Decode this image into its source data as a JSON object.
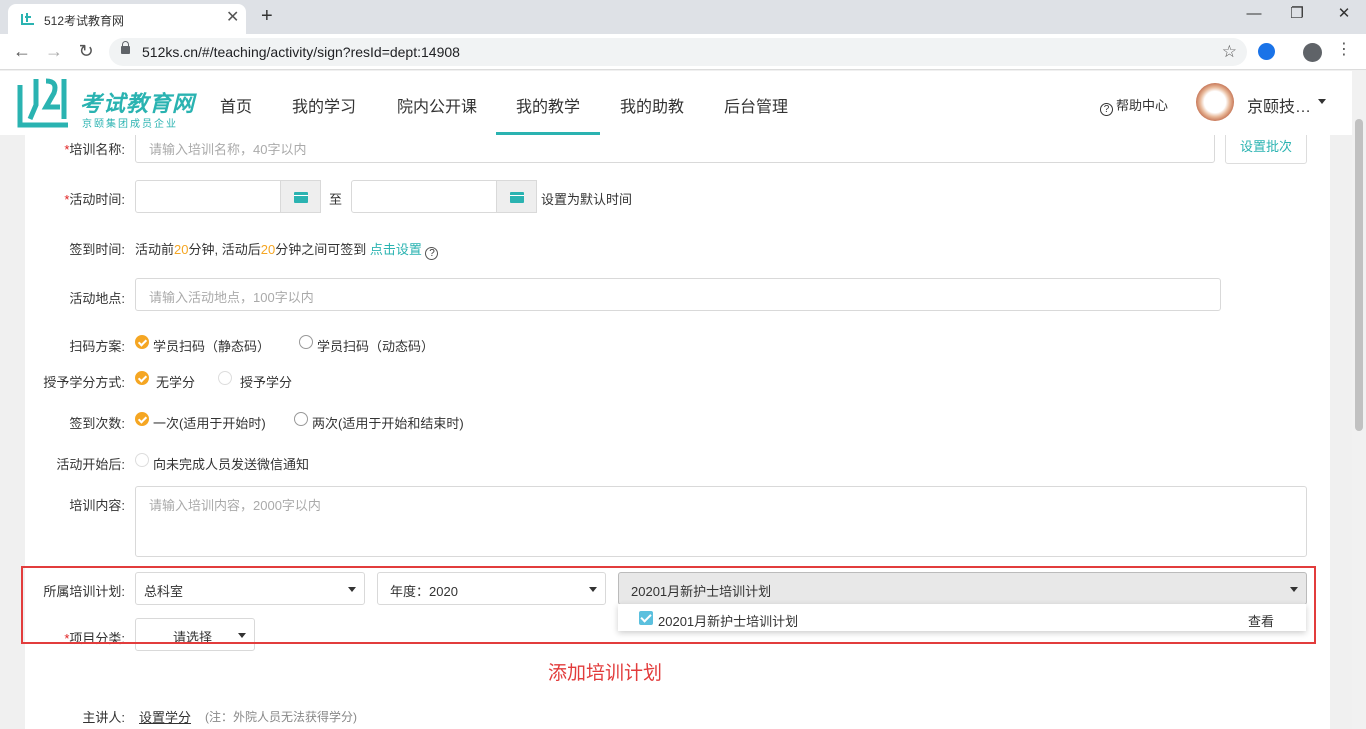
{
  "browser": {
    "tab_title": "512考试教育网",
    "close_glyph": "✕",
    "new_tab_glyph": "+",
    "win_min": "—",
    "win_max": "❐",
    "win_close": "✕",
    "back": "←",
    "forward": "→",
    "reload": "↻",
    "url": "512ks.cn/#/teaching/activity/sign?resId=dept:14908",
    "star": "☆",
    "kebab": "⋮"
  },
  "header": {
    "logo_text": "考试教育网",
    "logo_sub": "京颐集团成员企业",
    "menu": [
      "首页",
      "我的学习",
      "院内公开课",
      "我的教学",
      "我的助教",
      "后台管理"
    ],
    "active_menu": "我的教学",
    "help_icon": "?",
    "help_label": "帮助中心",
    "user_name": "京颐技…"
  },
  "form": {
    "training_name": {
      "req": "*",
      "label": "培训名称:",
      "placeholder": "请输入培训名称，40字以内",
      "batch_btn": "设置批次"
    },
    "activity_time": {
      "req": "*",
      "label": "活动时间:",
      "to": "至",
      "default_link": "设置为默认时间"
    },
    "sign_time": {
      "label": "签到时间:",
      "t1": "活动前",
      "n1": "20",
      "t2": "分钟, 活动后",
      "n2": "20",
      "t3": "分钟之间可签到",
      "link": "点击设置",
      "q": "?"
    },
    "location": {
      "label": "活动地点:",
      "placeholder": "请输入活动地点，100字以内"
    },
    "scan": {
      "label": "扫码方案:",
      "opt1": "学员扫码（静态码）",
      "opt2": "学员扫码（动态码）"
    },
    "credit": {
      "label": "授予学分方式:",
      "opt1": "无学分",
      "opt2": "授予学分"
    },
    "sign_count": {
      "label": "签到次数:",
      "opt1": "一次(适用于开始时)",
      "opt2": "两次(适用于开始和结束时)"
    },
    "after_start": {
      "label": "活动开始后:",
      "opt1": "向未完成人员发送微信通知"
    },
    "content": {
      "label": "培训内容:",
      "placeholder": "请输入培训内容，2000字以内"
    },
    "plan": {
      "label": "所属培训计划:",
      "dept": "总科室",
      "year": "年度：2020",
      "plan_selected": "20201月新护士培训计划",
      "option": "20201月新护士培训计划",
      "view": "查看"
    },
    "project": {
      "req": "*",
      "label": "项目分类:",
      "value": "请选择"
    },
    "speaker": {
      "label": "主讲人:",
      "link": "设置学分",
      "note": "(注：外院人员无法获得学分)"
    }
  },
  "annotation": "添加培训计划"
}
